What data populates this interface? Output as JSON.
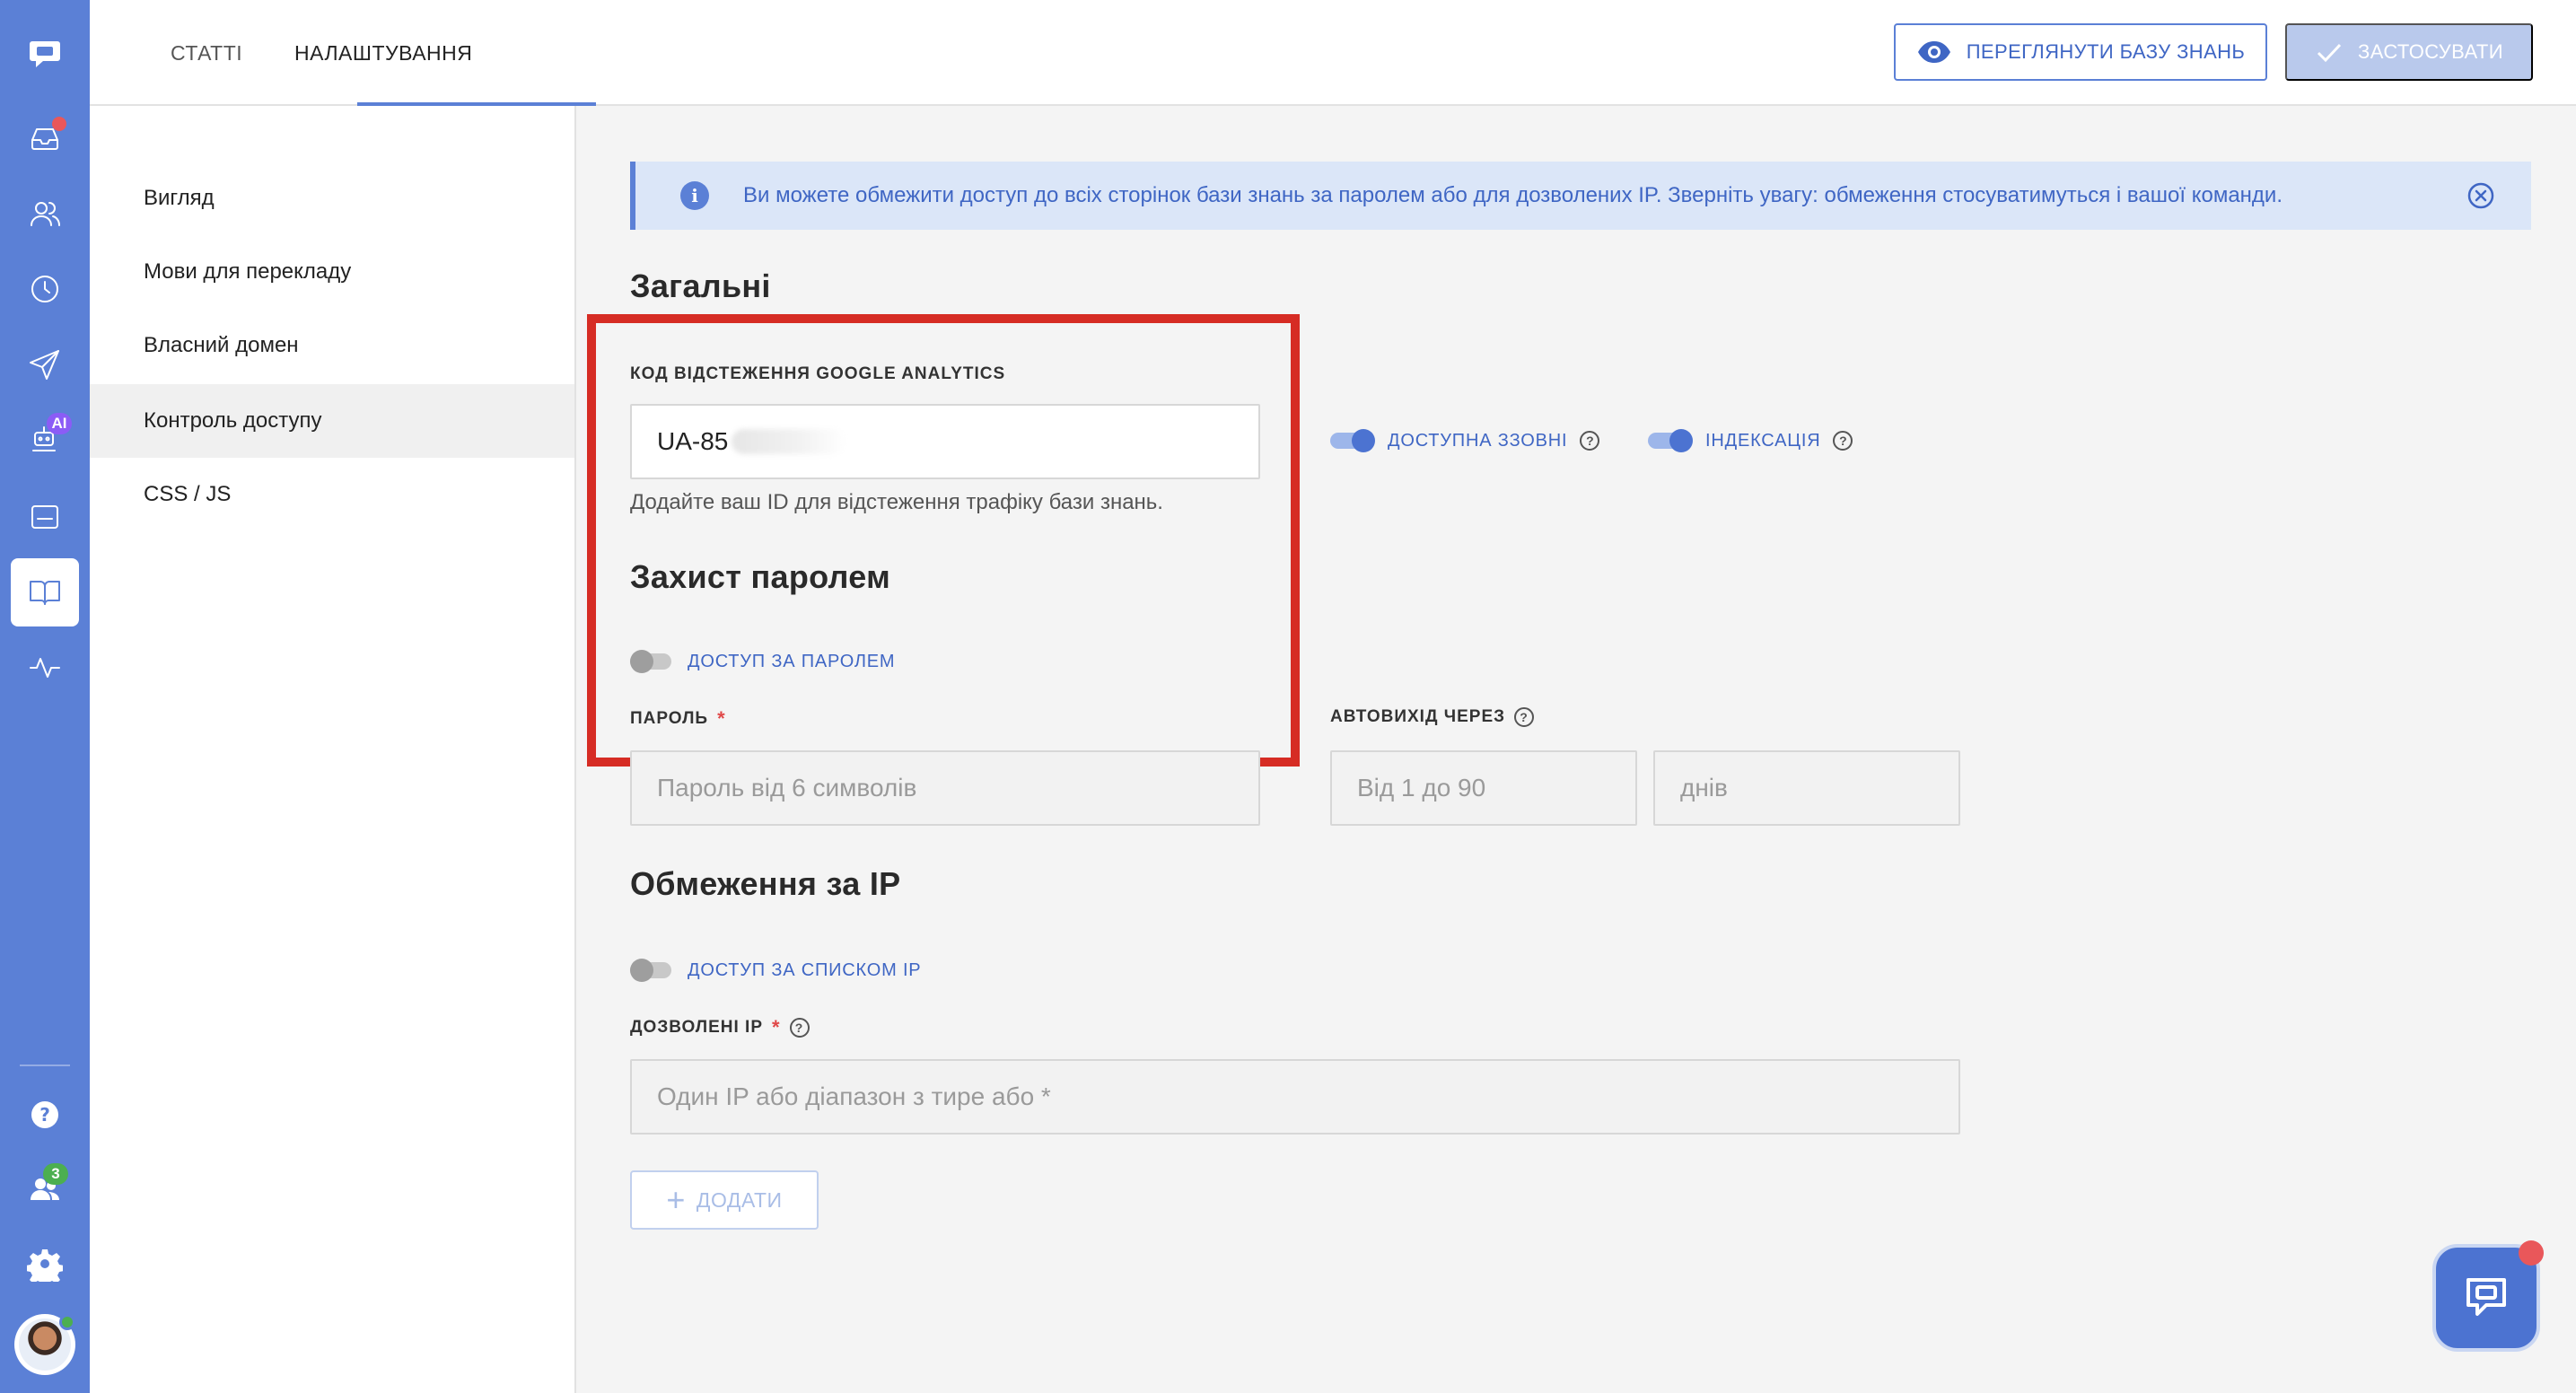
{
  "colors": {
    "accent": "#5b80d6",
    "banner_bg": "#dbe6f8",
    "highlight_red": "#d62c24",
    "notification_red": "#e9575a"
  },
  "rail": {
    "items": [
      {
        "name": "chat-logo-icon"
      },
      {
        "name": "inbox-icon"
      },
      {
        "name": "users-icon"
      },
      {
        "name": "clock-icon"
      },
      {
        "name": "send-icon"
      },
      {
        "name": "ai-bot-icon",
        "badge": "AI"
      },
      {
        "name": "widget-icon"
      },
      {
        "name": "knowledge-base-icon"
      },
      {
        "name": "analytics-icon"
      },
      {
        "name": "help-icon"
      },
      {
        "name": "team-icon",
        "badge": "3"
      },
      {
        "name": "settings-gear-icon"
      }
    ]
  },
  "header": {
    "tabs": [
      {
        "label": "СТАТТІ",
        "active": false
      },
      {
        "label": "НАЛАШТУВАННЯ",
        "active": true
      }
    ],
    "preview_button": "ПЕРЕГЛЯНУТИ БАЗУ ЗНАНЬ",
    "apply_button": "ЗАСТОСУВАТИ"
  },
  "settings_nav": {
    "items": [
      {
        "label": "Вигляд",
        "active": false
      },
      {
        "label": "Мови для перекладу",
        "active": false
      },
      {
        "label": "Власний домен",
        "active": false
      },
      {
        "label": "Контроль доступу",
        "active": true
      },
      {
        "label": "CSS / JS",
        "active": false
      }
    ]
  },
  "banner": {
    "text": "Ви можете обмежити доступ до всіх сторінок бази знань за паролем або для дозволених IP. Зверніть увагу: обмеження стосуватимуться і вашої команди."
  },
  "general": {
    "title": "Загальні",
    "ga_label": "КОД ВІДСТЕЖЕННЯ GOOGLE ANALYTICS",
    "ga_value": "UA-85",
    "ga_hint": "Додайте ваш ID для відстеження трафіку бази знань.",
    "public_toggle": {
      "label": "ДОСТУПНА ЗЗОВНІ",
      "on": true
    },
    "indexing_toggle": {
      "label": "ІНДЕКСАЦІЯ",
      "on": true
    }
  },
  "password": {
    "title": "Захист паролем",
    "toggle": {
      "label": "ДОСТУП ЗА ПАРОЛЕМ",
      "on": false
    },
    "password_label": "ПАРОЛЬ",
    "required_mark": "*",
    "password_placeholder": "Пароль від 6 символів",
    "autologout_label": "АВТОВИХІД ЧЕРЕЗ",
    "autologout_placeholder": "Від 1 до 90",
    "days_label": "днів"
  },
  "ip": {
    "title": "Обмеження за IP",
    "toggle": {
      "label": "ДОСТУП ЗА СПИСКОМ IP",
      "on": false
    },
    "allowed_label": "ДОЗВОЛЕНІ IP",
    "required_mark": "*",
    "allowed_placeholder": "Один IP або діапазон з тире або *",
    "add_button": "ДОДАТИ"
  }
}
